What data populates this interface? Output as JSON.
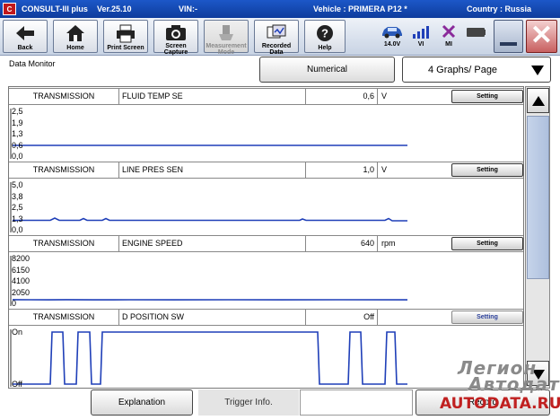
{
  "titlebar": {
    "logo": "C",
    "app": "CONSULT-III plus",
    "version": "Ver.25.10",
    "vin": "VIN:-",
    "vehicle": "Vehicle : PRIMERA P12 *",
    "country": "Country : Russia"
  },
  "toolbar": {
    "back": "Back",
    "home": "Home",
    "print": "Print Screen",
    "capture_l1": "Screen",
    "capture_l2": "Capture",
    "measure_l1": "Measurement",
    "measure_l2": "Mode",
    "recorded_l1": "Recorded",
    "recorded_l2": "Data",
    "help": "Help",
    "battery": "14.0V",
    "vi": "VI",
    "mi": "MI"
  },
  "monitor": {
    "title": "Data Monitor",
    "numerical": "Numerical",
    "graphs_per_page": "4 Graphs/ Page"
  },
  "graphs": [
    {
      "group": "TRANSMISSION",
      "name": "FLUID TEMP SE",
      "value": "0,6",
      "unit": "V",
      "setting": "Setting",
      "yticks": [
        "2,5",
        "1,9",
        "1,3",
        "0,6",
        "0,0"
      ],
      "ymin": 0.0,
      "ymax": 2.5,
      "trace": [
        [
          0,
          0.6
        ],
        [
          440,
          0.6
        ]
      ]
    },
    {
      "group": "TRANSMISSION",
      "name": "LINE PRES SEN",
      "value": "1,0",
      "unit": "V",
      "setting": "Setting",
      "yticks": [
        "5,0",
        "3,8",
        "2,5",
        "1,3",
        "0,0"
      ],
      "ymin": 0.0,
      "ymax": 5.0,
      "trace": [
        [
          0,
          1.05
        ],
        [
          42,
          1.05
        ],
        [
          47,
          1.3
        ],
        [
          52,
          1.05
        ],
        [
          75,
          1.05
        ],
        [
          79,
          1.25
        ],
        [
          83,
          1.05
        ],
        [
          100,
          1.05
        ],
        [
          104,
          1.25
        ],
        [
          108,
          1.05
        ],
        [
          320,
          1.05
        ],
        [
          323,
          1.2
        ],
        [
          327,
          1.05
        ],
        [
          415,
          1.05
        ],
        [
          419,
          1.25
        ],
        [
          423,
          1.0
        ],
        [
          440,
          1.0
        ]
      ]
    },
    {
      "group": "TRANSMISSION",
      "name": "ENGINE SPEED",
      "value": "640",
      "unit": "rpm",
      "setting": "Setting",
      "yticks": [
        "8200",
        "6150",
        "4100",
        "2050",
        "0"
      ],
      "ymin": 0,
      "ymax": 8200,
      "trace": [
        [
          0,
          680
        ],
        [
          20,
          650
        ],
        [
          40,
          640
        ],
        [
          60,
          670
        ],
        [
          90,
          640
        ],
        [
          130,
          660
        ],
        [
          180,
          640
        ],
        [
          240,
          650
        ],
        [
          300,
          640
        ],
        [
          360,
          660
        ],
        [
          440,
          640
        ]
      ]
    },
    {
      "group": "TRANSMISSION",
      "name": "D POSITION SW",
      "value": "Off",
      "unit": "",
      "setting": "Setting",
      "yticks": [
        "On",
        "Off"
      ],
      "ymin": 0,
      "ymax": 1,
      "trace": [
        [
          0,
          0
        ],
        [
          42,
          0
        ],
        [
          44,
          1
        ],
        [
          56,
          1
        ],
        [
          58,
          0
        ],
        [
          71,
          0
        ],
        [
          73,
          1
        ],
        [
          86,
          1
        ],
        [
          88,
          0
        ],
        [
          98,
          0
        ],
        [
          100,
          1
        ],
        [
          340,
          1
        ],
        [
          342,
          0
        ],
        [
          374,
          0
        ],
        [
          376,
          1
        ],
        [
          388,
          1
        ],
        [
          390,
          0
        ],
        [
          415,
          0
        ],
        [
          417,
          1
        ],
        [
          426,
          1
        ],
        [
          428,
          0
        ],
        [
          440,
          0
        ]
      ]
    }
  ],
  "footer": {
    "explanation": "Explanation",
    "trigger": "Trigger Info.",
    "record": "Record"
  },
  "watermark": {
    "line1": "Легион",
    "line2": "Автодата",
    "line3": "AUTODATA.RU"
  },
  "colors": {
    "trace": "#1f3fb8",
    "titlebar": "#1848b8",
    "close": "#c84040"
  }
}
